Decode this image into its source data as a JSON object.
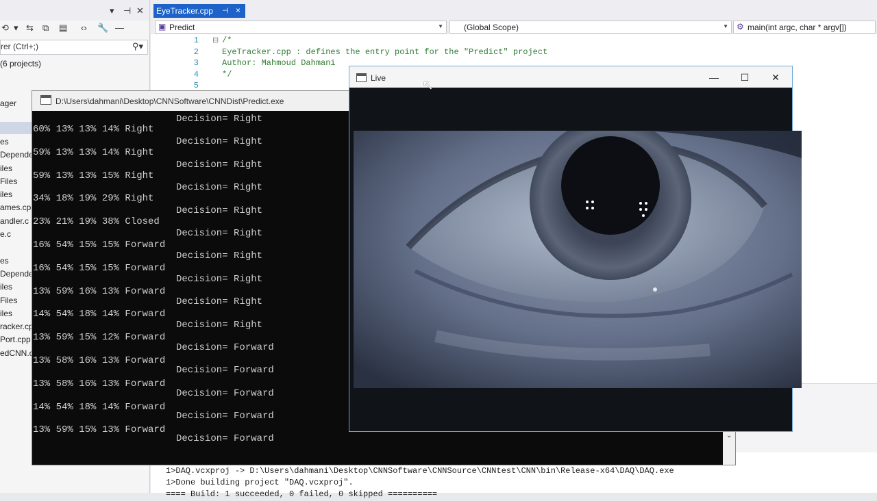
{
  "solution_explorer": {
    "search_placeholder": "rer (Ctrl+;)",
    "projects_count": "(6 projects)",
    "manager_label": "ager",
    "tree_items": [
      "es",
      "Depende",
      "iles",
      "Files",
      "iles",
      "ames.cp",
      "andler.c",
      "e.c",
      "",
      "es",
      "Depende",
      "iles",
      "Files",
      "iles",
      "racker.cp",
      "Port.cpp",
      "edCNN.c"
    ]
  },
  "editor": {
    "tab_title": "EyeTracker.cpp",
    "tab_pin": "⊣",
    "tab_close": "×",
    "nav_project": "Predict",
    "nav_scope": "(Global Scope)",
    "nav_member": "main(int argc, char * argv[])",
    "line_numbers": [
      "1",
      "2",
      "3",
      "4",
      "5"
    ],
    "fold_marker": "⊟",
    "code_lines": [
      "/*",
      "EyeTracker.cpp : defines the entry point for the \"Predict\" project",
      "Author: Mahmoud Dahmani",
      "*/",
      ""
    ],
    "output_lines": [
      "1>Finished generating code",
      "1>DAQ.vcxproj -> D:\\Users\\dahmani\\Desktop\\CNNSoftware\\CNNSource\\CNNtest\\CNN\\bin\\Release-x64\\DAQ\\DAQ.exe",
      "1>Done building project \"DAQ.vcxproj\".",
      "==== Build: 1 succeeded, 0 failed, 0 skipped =========="
    ]
  },
  "console": {
    "title": "D:\\Users\\dahmani\\Desktop\\CNNSoftware\\CNNDist\\Predict.exe",
    "prob_lines": [
      "60% 13% 13% 14% Right",
      "59% 13% 13% 14% Right",
      "59% 13% 13% 15% Right",
      "34% 18% 19% 29% Right",
      "23% 21% 19% 38% Closed",
      "16% 54% 15% 15% Forward",
      "16% 54% 15% 15% Forward",
      "13% 59% 16% 13% Forward",
      "14% 54% 18% 14% Forward",
      "13% 59% 15% 12% Forward",
      "13% 58% 16% 13% Forward",
      "13% 58% 16% 13% Forward",
      "14% 54% 18% 14% Forward",
      "13% 59% 15% 13% Forward"
    ],
    "decision_lines": [
      "Decision= Right",
      "Decision= Right",
      "Decision= Right",
      "Decision= Right",
      "Decision= Right",
      "Decision= Right",
      "Decision= Right",
      "Decision= Right",
      "Decision= Right",
      "Decision= Right",
      "Decision= Forward",
      "Decision= Forward",
      "Decision= Forward",
      "Decision= Forward",
      "Decision= Forward"
    ],
    "scroll_arrow": "⌄"
  },
  "live": {
    "title": "Live",
    "minimize": "—",
    "maximize": "☐",
    "close": "✕"
  },
  "colors": {
    "tab_active": "#1c62c8",
    "console_bg": "#0b0b0b",
    "console_text": "#cfcfcf",
    "comment_green": "#2e7d32",
    "line_number_blue": "#2b91af",
    "live_border": "#6aa7d9"
  },
  "icons": [
    "pin-icon",
    "close-icon",
    "search-icon",
    "console-window-icon",
    "live-window-icon",
    "cursor-icon",
    "dropdown-arrow-icon",
    "method-icon"
  ]
}
